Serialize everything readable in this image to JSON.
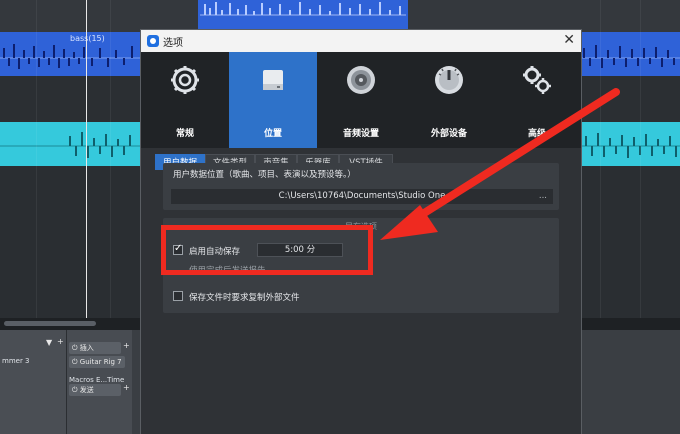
{
  "background": {
    "clip_label": "bass(15)",
    "mixer": {
      "track_name": "mmer 3",
      "insert_label": "插入",
      "insert_plugin": "Guitar Rig 7",
      "send_label": "发送",
      "macros_label": "Macros E...Time"
    }
  },
  "dialog": {
    "title": "选项",
    "close": "✕",
    "categories": [
      {
        "label": "常规",
        "icon": "gear-icon"
      },
      {
        "label": "位置",
        "icon": "drive-icon"
      },
      {
        "label": "音频设置",
        "icon": "speaker-icon"
      },
      {
        "label": "外部设备",
        "icon": "dial-icon"
      },
      {
        "label": "高级",
        "icon": "gears-icon"
      }
    ],
    "selected_category": "位置",
    "tabs": [
      "用户数据",
      "文件类型",
      "声音集",
      "乐器库",
      "VST插件"
    ],
    "selected_tab": "用户数据",
    "user_data": {
      "heading": "用户数据位置（歌曲、项目、表演以及预设等。）",
      "path": "C:\\Users\\10764\\Documents\\Studio One",
      "browse": "..."
    },
    "file_handling": {
      "section_title": "目存选项",
      "autosave_label": "启用自动保存",
      "autosave_checked": true,
      "autosave_value": "5:00 分",
      "hidden_option_label": "使用完成后发送报告",
      "copy_external_label": "保存文件时要求复制外部文件",
      "copy_external_checked": false
    }
  },
  "colors": {
    "accent": "#2e72c9",
    "annotation": "#ef2a20",
    "track_blue": "#2f62d8",
    "track_cyan": "#35c9dc"
  }
}
